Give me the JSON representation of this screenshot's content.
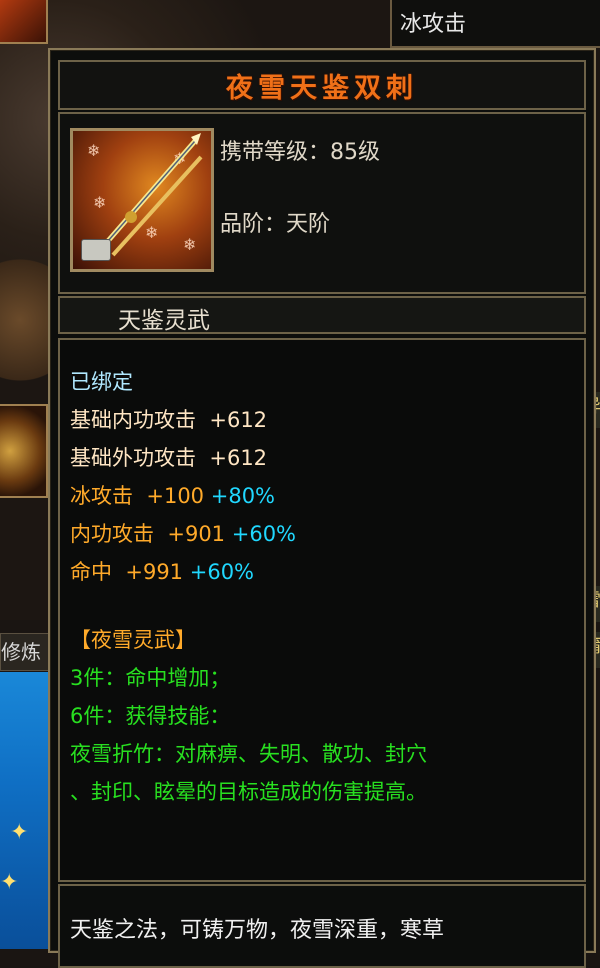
{
  "tooltip": {
    "item_name": "夜雪天鉴双刺",
    "carry_level": "携带等级：85级",
    "grade": "品阶：天阶",
    "category": "天鉴灵武",
    "bound": "已绑定",
    "stats": [
      {
        "name": "基础内功攻击",
        "value": "+612",
        "bonus": ""
      },
      {
        "name": "基础外功攻击",
        "value": "+612",
        "bonus": ""
      },
      {
        "name": "冰攻击",
        "value": "+100",
        "bonus": "+80%"
      },
      {
        "name": "内功攻击",
        "value": "+901",
        "bonus": "+60%"
      },
      {
        "name": "命中",
        "value": "+991",
        "bonus": "+60%"
      }
    ],
    "set": {
      "name": "【夜雪灵武】",
      "bonus3": "3件：命中增加；",
      "bonus6": "6件：获得技能：",
      "skill_line1": "夜雪折竹：对麻痹、失明、散功、封穴",
      "skill_line2": "、封印、眩晕的目标造成的伤害提高。"
    },
    "lore": "天鉴之法，可铸万物，夜雪深重，寒草"
  },
  "background": {
    "right_panel_label": "冰攻击",
    "left_label": "修炼",
    "edge_chars": [
      "异",
      "雪",
      "蒲"
    ]
  },
  "colors": {
    "title": "#f07018",
    "bound": "#b0e8ff",
    "base_stat": "#ffe6c4",
    "elem_stat": "#ffaa2a",
    "bonus": "#20d8ff",
    "set": "#28e020"
  }
}
